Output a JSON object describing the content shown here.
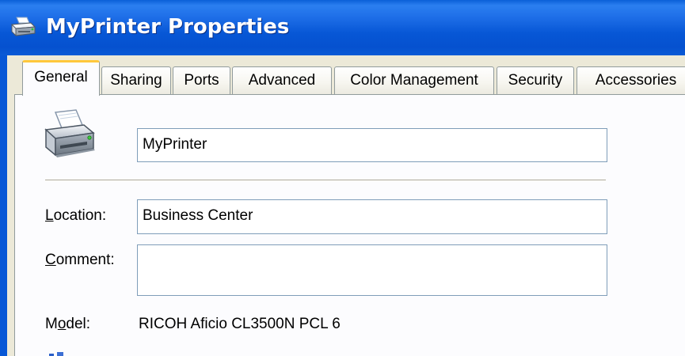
{
  "window": {
    "title": "MyPrinter Properties"
  },
  "tabs": [
    {
      "label": "General",
      "active": true
    },
    {
      "label": "Sharing",
      "active": false
    },
    {
      "label": "Ports",
      "active": false
    },
    {
      "label": "Advanced",
      "active": false
    },
    {
      "label": "Color Management",
      "active": false
    },
    {
      "label": "Security",
      "active": false
    },
    {
      "label": "Accessories",
      "active": false
    }
  ],
  "general": {
    "printer_name": "MyPrinter",
    "location": {
      "label_accel": "L",
      "label_rest": "ocation:",
      "value": "Business Center"
    },
    "comment": {
      "label_accel": "C",
      "label_rest": "omment:",
      "value": ""
    },
    "model": {
      "label_pre": "M",
      "label_accel": "o",
      "label_rest": "del:",
      "value": "RICOH Aficio CL3500N PCL 6"
    }
  },
  "icons": {
    "title": "printer-icon",
    "main": "printer-icon"
  },
  "colors": {
    "titlebar": "#0757d6",
    "dialog_bg": "#ece9d8",
    "panel_bg": "#fcfcfe",
    "active_tab_accent": "#ffc83c",
    "textbox_border": "#7f9db9"
  }
}
